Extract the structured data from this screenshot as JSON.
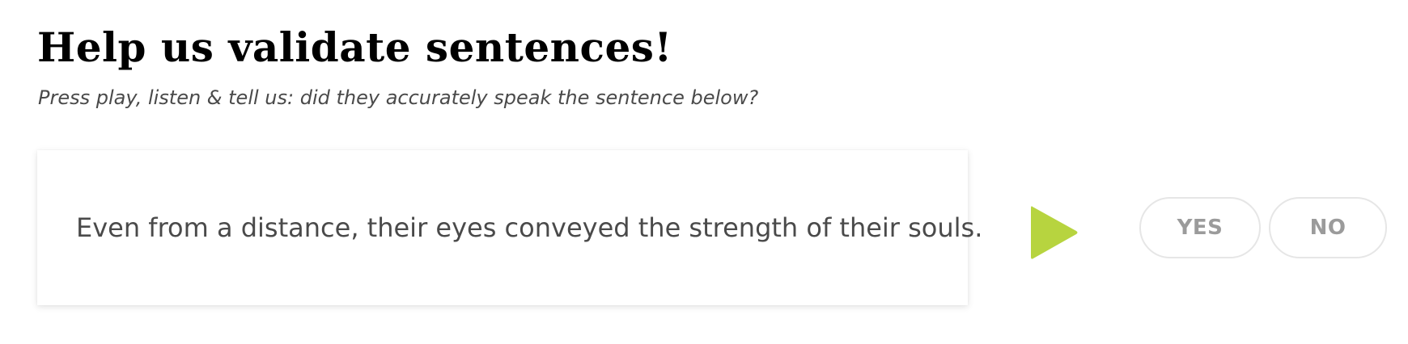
{
  "header": {
    "title": "Help us validate sentences!",
    "subtitle": "Press play, listen & tell us: did they accurately speak the sentence below?"
  },
  "card": {
    "sentence": "Even from a distance, their eyes conveyed the strength of their souls."
  },
  "controls": {
    "play_icon": "play-icon",
    "play_color": "#b7d43f",
    "yes_label": "YES",
    "no_label": "NO"
  }
}
